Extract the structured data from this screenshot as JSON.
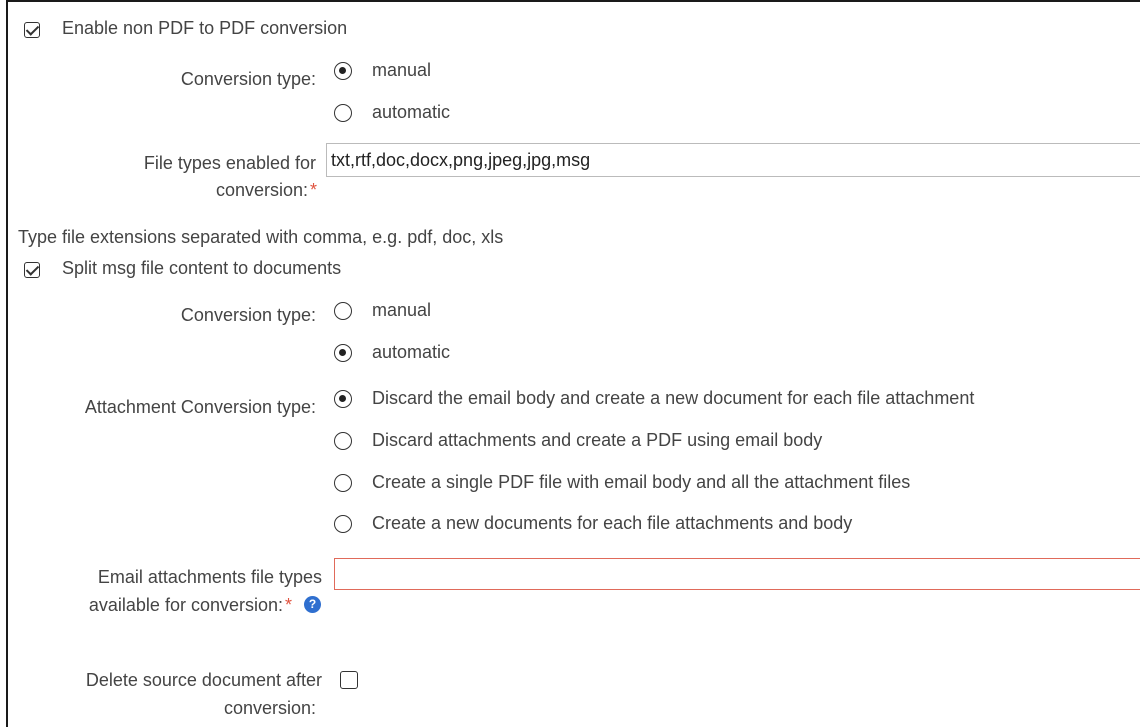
{
  "enable_conversion": {
    "label": "Enable non PDF to PDF conversion",
    "checked": true
  },
  "conversion_type_1": {
    "label": "Conversion type:",
    "options": [
      "manual",
      "automatic"
    ],
    "selected": "manual"
  },
  "file_types": {
    "label_line1": "File types enabled for",
    "label_line2": "conversion:",
    "required": "*",
    "value": "txt,rtf,doc,docx,png,jpeg,jpg,msg"
  },
  "hint": "Type file extensions separated with comma, e.g. pdf, doc, xls",
  "split_msg": {
    "label": "Split msg file content to documents",
    "checked": true
  },
  "conversion_type_2": {
    "label": "Conversion type:",
    "options": [
      "manual",
      "automatic"
    ],
    "selected": "automatic"
  },
  "attachment_conversion": {
    "label": "Attachment Conversion type:",
    "options": [
      "Discard the email body and create a new document for each file attachment",
      "Discard attachments and create a PDF using email body",
      "Create a single PDF file with email body and all the attachment files",
      "Create a new documents for each file attachments and body"
    ],
    "selected_index": 0
  },
  "email_attachments": {
    "label_line1": "Email attachments file types",
    "label_line2": "available for conversion:",
    "required": "*",
    "value": "",
    "help_icon": "question-circle-icon"
  },
  "delete_source": {
    "label_line1": "Delete source document after",
    "label_line2": "conversion:",
    "checked": false
  }
}
